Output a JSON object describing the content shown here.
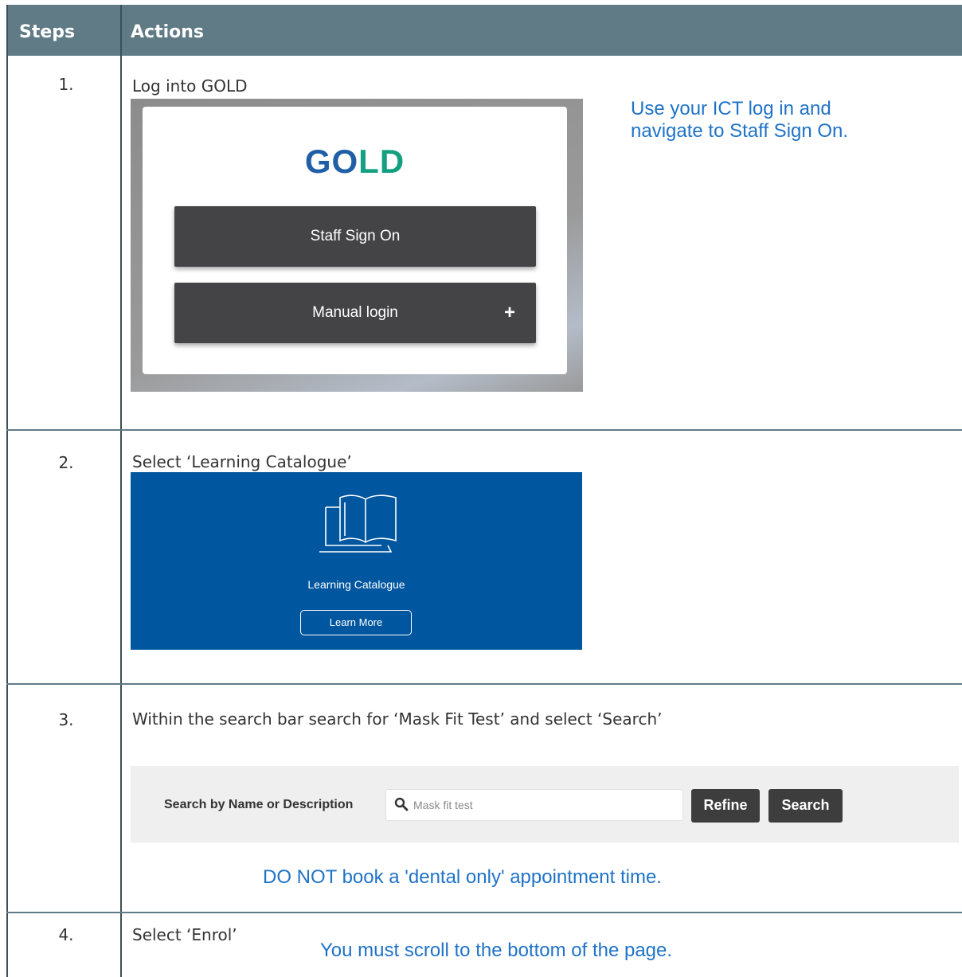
{
  "table": {
    "headers": {
      "steps": "Steps",
      "actions": "Actions"
    },
    "rows": [
      {
        "num": "1.",
        "action": "Log into GOLD",
        "note": [
          "Use your ICT log in and",
          "navigate to Staff Sign On."
        ]
      },
      {
        "num": "2.",
        "action": "Select ‘Learning Catalogue’"
      },
      {
        "num": "3.",
        "action": "Within the search bar search for ‘Mask Fit Test’ and select ‘Search’",
        "note": "DO NOT book a 'dental only' appointment time."
      },
      {
        "num": "4.",
        "action": "Select ‘Enrol’",
        "note": "You must scroll to the bottom of the page."
      }
    ]
  },
  "gold_login": {
    "logo_part1": "GO",
    "logo_part2": "LD",
    "staff_button": "Staff Sign On",
    "manual_button": "Manual login",
    "manual_icon": "+"
  },
  "learning_catalogue": {
    "icon": "book-laptop-icon",
    "label": "Learning Catalogue",
    "button": "Learn More"
  },
  "search": {
    "label": "Search by Name or Description",
    "value": "Mask fit test",
    "refine_button": "Refine",
    "search_button": "Search",
    "icon": "search-icon"
  },
  "colors": {
    "header_bg": "#607b86",
    "note_blue": "#1f73c7",
    "tile_blue": "#00569f",
    "gold_blue": "#1f5fa6",
    "gold_green": "#13a080"
  }
}
